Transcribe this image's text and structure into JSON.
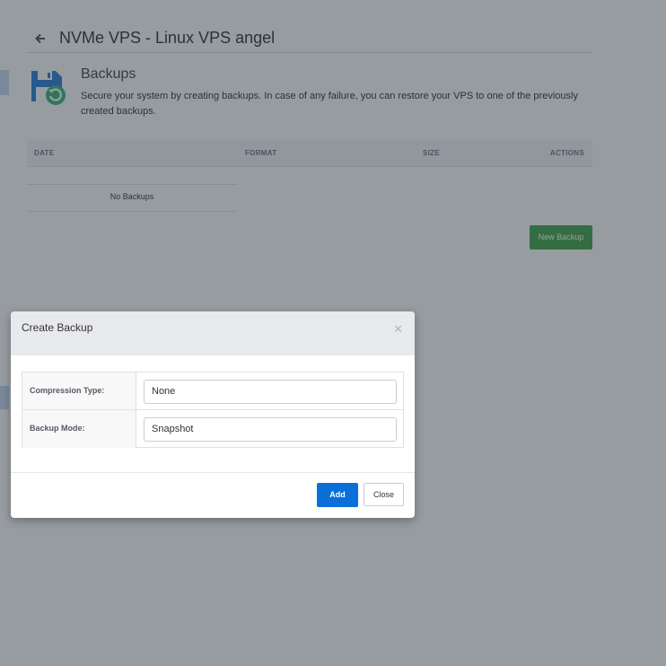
{
  "header": {
    "title": "NVMe VPS - Linux VPS angel",
    "back_icon": "arrow-left-icon"
  },
  "backups": {
    "icon": "floppy-disk-restore-icon",
    "title": "Backups",
    "description": "Secure your system by creating backups. In case of any failure, you can restore your VPS to one of the previously created backups."
  },
  "table": {
    "columns": [
      "DATE",
      "FORMAT",
      "SIZE",
      "ACTIONS"
    ],
    "empty_text": "No Backups"
  },
  "new_backup_button": "New Backup",
  "modal": {
    "title": "Create Backup",
    "close_icon": "close-icon",
    "fields": [
      {
        "label": "Compression Type:",
        "value": "None"
      },
      {
        "label": "Backup Mode:",
        "value": "Snapshot"
      }
    ],
    "add_button": "Add",
    "close_button": "Close"
  },
  "colors": {
    "primary_blue": "#0a6fd9",
    "success_green": "#43a64a",
    "overlay": "rgba(38,48,58,0.48)"
  }
}
